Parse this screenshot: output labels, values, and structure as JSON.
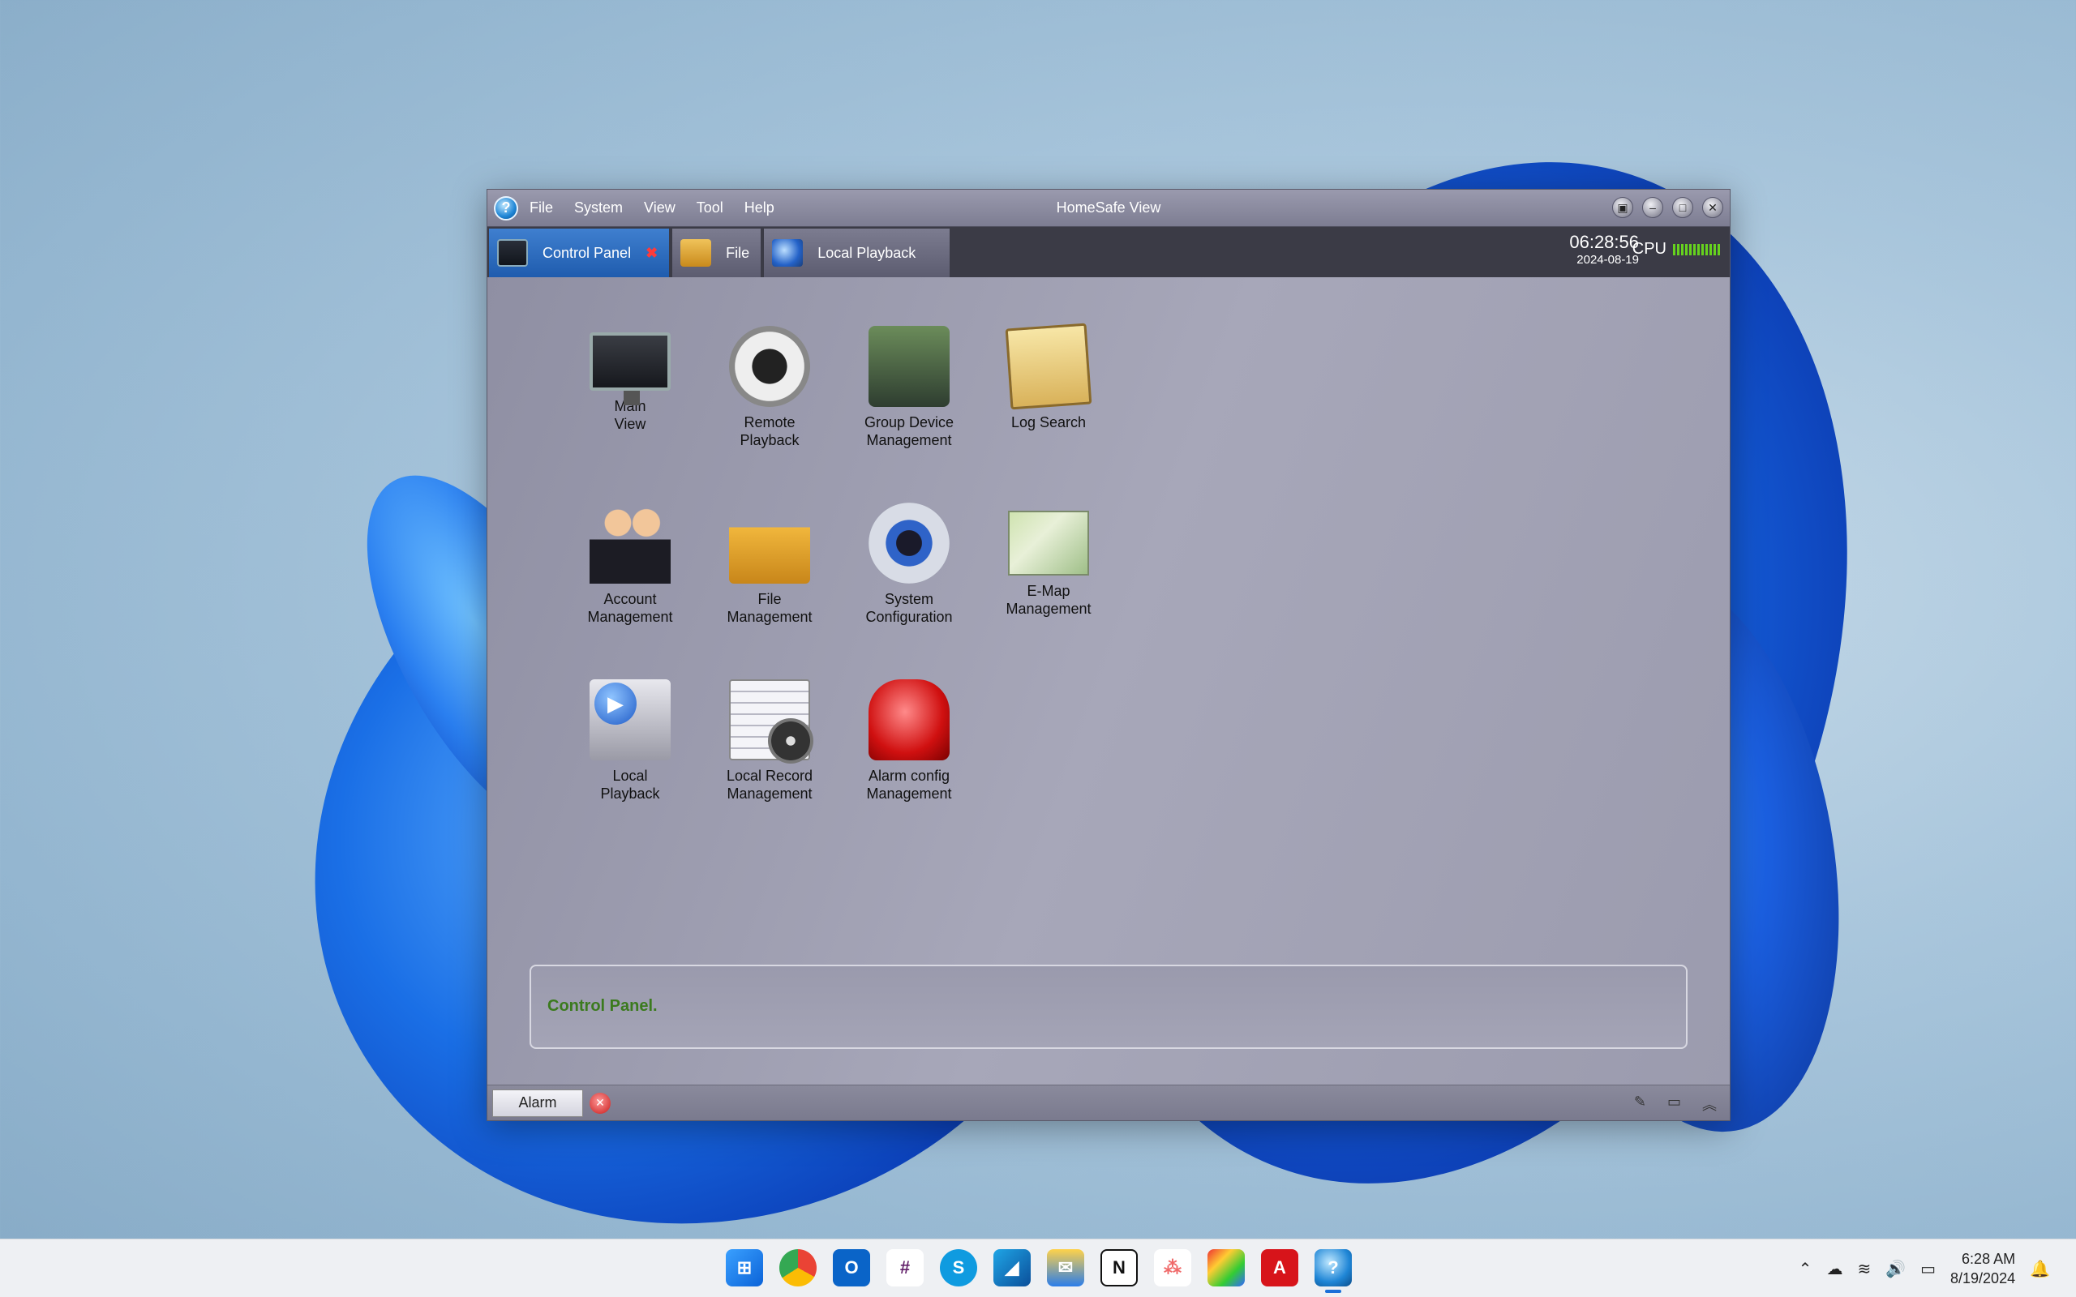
{
  "window": {
    "title": "HomeSafe View",
    "menu": [
      "File",
      "System",
      "View",
      "Tool",
      "Help"
    ],
    "controls": {
      "lock": "lock-icon",
      "minimize": "minimize-icon",
      "maximize": "maximize-icon",
      "close": "close-icon"
    }
  },
  "tabs": [
    {
      "label": "Control Panel",
      "icon": "control-panel-icon",
      "active": true,
      "close_glyph": "✖"
    },
    {
      "label": "File",
      "icon": "folder-icon",
      "active": false
    },
    {
      "label": "Local Playback",
      "icon": "local-playback-icon",
      "active": false
    }
  ],
  "clock": {
    "time": "06:28:56",
    "date": "2024-08-19"
  },
  "cpu": {
    "label": "CPU",
    "bar_color": "#66d21e"
  },
  "panel_items": [
    {
      "label": "Main\nView",
      "icon": "monitor-icon"
    },
    {
      "label": "Remote\nPlayback",
      "icon": "remote-playback-icon"
    },
    {
      "label": "Group Device\nManagement",
      "icon": "group-device-icon"
    },
    {
      "label": "Log Search",
      "icon": "log-search-icon"
    },
    {
      "label": "Account\nManagement",
      "icon": "account-icon"
    },
    {
      "label": "File\nManagement",
      "icon": "file-management-icon"
    },
    {
      "label": "System\nConfiguration",
      "icon": "system-config-icon"
    },
    {
      "label": "E-Map\nManagement",
      "icon": "emap-icon"
    },
    {
      "label": "Local\nPlayback",
      "icon": "local-playback-icon"
    },
    {
      "label": "Local Record\nManagement",
      "icon": "local-record-icon"
    },
    {
      "label": "Alarm config\nManagement",
      "icon": "alarm-config-icon"
    }
  ],
  "status_text": "Control Panel.",
  "status_color": "#3b7a1e",
  "bottom": {
    "alarm_label": "Alarm",
    "icons": [
      "pin-icon",
      "window-icon",
      "expand-up-icon"
    ]
  },
  "taskbar": {
    "apps": [
      "windows-start-icon",
      "chrome-icon",
      "outlook-icon",
      "slack-icon",
      "skype-icon",
      "app-icon",
      "mail-icon",
      "notion-icon",
      "asana-icon",
      "photos-icon",
      "acrobat-icon",
      "homesafe-view-icon"
    ],
    "tray": {
      "time": "6:28 AM",
      "date": "8/19/2024"
    }
  }
}
